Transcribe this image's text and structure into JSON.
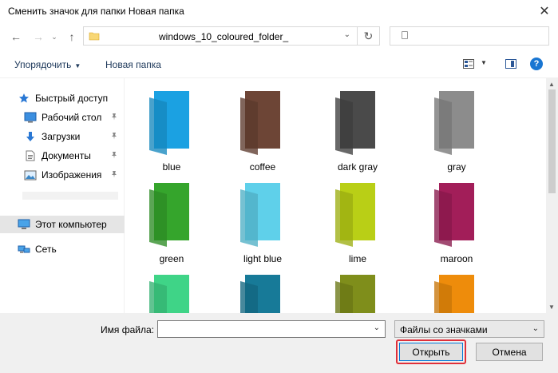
{
  "window": {
    "title": "Сменить значок для папки Новая папка",
    "close_glyph": "✕"
  },
  "nav": {
    "back_glyph": "←",
    "forward_glyph": "→",
    "recent_glyph": "⌄",
    "up_glyph": "↑",
    "refresh_glyph": "↻",
    "address_path": "windows_10_coloured_folder_",
    "address_dropdown_glyph": "⌄"
  },
  "toolbar": {
    "organize_label": "Упорядочить",
    "organize_caret": "▼",
    "new_folder_label": "Новая папка",
    "view_dropdown_glyph": "▼",
    "help_glyph": "?"
  },
  "navigation_pane": {
    "items": [
      {
        "label": "Быстрый доступ",
        "icon": "star-icon"
      },
      {
        "label": "Рабочий стол",
        "icon": "desktop-icon",
        "pinned": true
      },
      {
        "label": "Загрузки",
        "icon": "download-icon",
        "pinned": true
      },
      {
        "label": "Документы",
        "icon": "document-icon",
        "pinned": true
      },
      {
        "label": "Изображения",
        "icon": "pictures-icon",
        "pinned": true
      },
      {
        "label": "Этот компьютер",
        "icon": "computer-icon",
        "selected": true
      },
      {
        "label": "Сеть",
        "icon": "network-icon"
      }
    ],
    "pin_glyph": "📌"
  },
  "files": [
    {
      "label": "blue",
      "color": "#1ba1e2"
    },
    {
      "label": "coffee",
      "color": "#6d4536"
    },
    {
      "label": "dark gray",
      "color": "#4a4a4a"
    },
    {
      "label": "gray",
      "color": "#8c8c8c"
    },
    {
      "label": "green",
      "color": "#35a52c"
    },
    {
      "label": "light blue",
      "color": "#5fd0ea"
    },
    {
      "label": "lime",
      "color": "#b9cf16"
    },
    {
      "label": "maroon",
      "color": "#a21e59"
    },
    {
      "label": "",
      "color": "#3fd487"
    },
    {
      "label": "",
      "color": "#177a98"
    },
    {
      "label": "",
      "color": "#7f8e1b"
    },
    {
      "label": "",
      "color": "#ee8c0b"
    }
  ],
  "scrollbar": {
    "up_glyph": "▲",
    "down_glyph": "▼"
  },
  "footer": {
    "filename_label": "Имя файла:",
    "filename_value": "",
    "filetype_value": "Файлы со значками",
    "dropdown_glyph": "⌄",
    "open_label": "Открыть",
    "cancel_label": "Отмена"
  }
}
